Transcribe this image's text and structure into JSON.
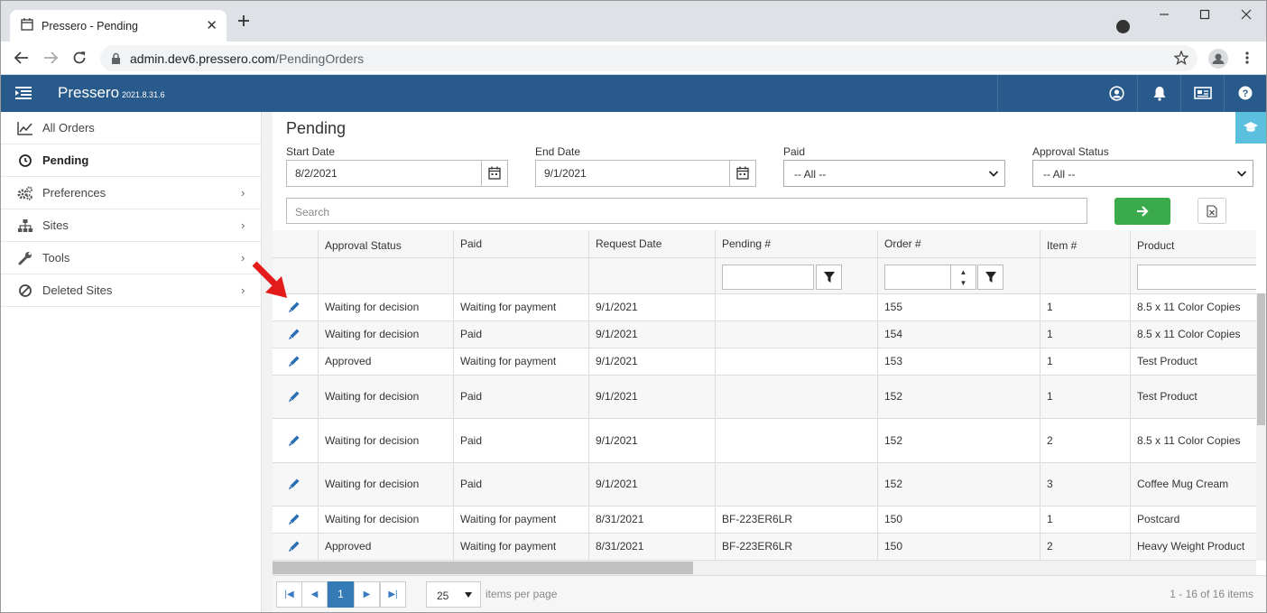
{
  "browser": {
    "tab_title": "Pressero - Pending",
    "url_host": "admin.dev6.pressero.com",
    "url_path": "/PendingOrders"
  },
  "app": {
    "name": "Pressero",
    "version": "2021.8.31.6",
    "header_color": "#285a8b"
  },
  "sidebar": {
    "items": [
      {
        "label": "All Orders",
        "icon": "line-chart-icon"
      },
      {
        "label": "Pending",
        "icon": "clock-icon",
        "active": true
      },
      {
        "label": "Preferences",
        "icon": "cogs-icon"
      },
      {
        "label": "Sites",
        "icon": "sitemap-icon"
      },
      {
        "label": "Tools",
        "icon": "wrench-icon"
      },
      {
        "label": "Deleted Sites",
        "icon": "ban-icon"
      }
    ]
  },
  "page": {
    "title": "Pending",
    "filters": {
      "start_date_label": "Start Date",
      "start_date_value": "8/2/2021",
      "end_date_label": "End Date",
      "end_date_value": "9/1/2021",
      "paid_label": "Paid",
      "paid_value": "-- All --",
      "approval_label": "Approval Status",
      "approval_value": "-- All --"
    },
    "search_placeholder": "Search",
    "go_color": "#3aaa4b"
  },
  "grid": {
    "columns": [
      "Approval Status",
      "Paid",
      "Request Date",
      "Pending #",
      "Order #",
      "Item #",
      "Product"
    ],
    "rows": [
      [
        "Waiting for decision",
        "Waiting for payment",
        "9/1/2021",
        "",
        "155",
        "1",
        "8.5 x 11 Color Copies"
      ],
      [
        "Waiting for decision",
        "Paid",
        "9/1/2021",
        "",
        "154",
        "1",
        "8.5 x 11 Color Copies"
      ],
      [
        "Approved",
        "Waiting for payment",
        "9/1/2021",
        "",
        "153",
        "1",
        "Test Product"
      ],
      [
        "Waiting for decision",
        "Paid",
        "9/1/2021",
        "",
        "152",
        "1",
        "Test Product"
      ],
      [
        "Waiting for decision",
        "Paid",
        "9/1/2021",
        "",
        "152",
        "2",
        "8.5 x 11 Color Copies"
      ],
      [
        "Waiting for decision",
        "Paid",
        "9/1/2021",
        "",
        "152",
        "3",
        "Coffee Mug Cream"
      ],
      [
        "Waiting for decision",
        "Waiting for payment",
        "8/31/2021",
        "BF-223ER6LR",
        "150",
        "1",
        "Postcard"
      ],
      [
        "Approved",
        "Waiting for payment",
        "8/31/2021",
        "BF-223ER6LR",
        "150",
        "2",
        "Heavy Weight Product"
      ]
    ]
  },
  "pager": {
    "current_page": "1",
    "page_size": "25",
    "items_per_page_label": "items per page",
    "info": "1 - 16 of 16 items"
  }
}
